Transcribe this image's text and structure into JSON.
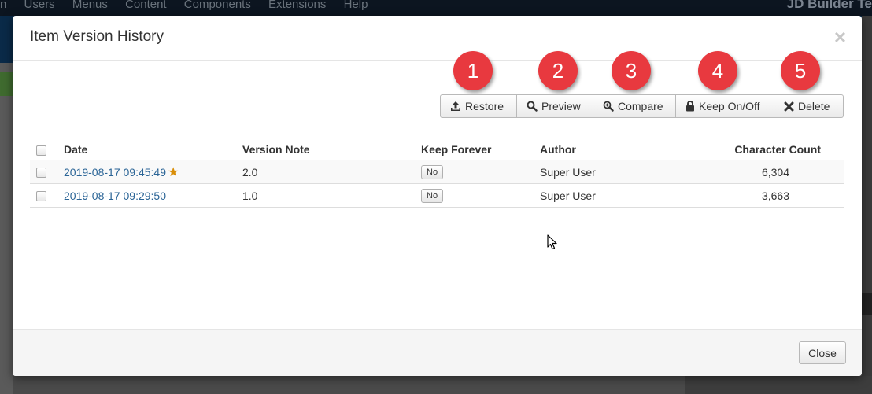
{
  "background": {
    "menu": [
      "n",
      "Users",
      "Menus",
      "Content",
      "Components",
      "Extensions",
      "Help"
    ],
    "brand": "JD Builder Te"
  },
  "modal": {
    "title": "Item Version History",
    "close_glyph": "×"
  },
  "toolbar": {
    "restore_label": "Restore",
    "preview_label": "Preview",
    "compare_label": "Compare",
    "keep_label": "Keep On/Off",
    "delete_label": "Delete"
  },
  "annotations": [
    "1",
    "2",
    "3",
    "4",
    "5"
  ],
  "table": {
    "columns": [
      "Date",
      "Version Note",
      "Keep Forever",
      "Author",
      "Character Count"
    ],
    "rows": [
      {
        "date": "2019-08-17 09:45:49",
        "starred": true,
        "note": "2.0",
        "keep": "No",
        "author": "Super User",
        "count": "6,304"
      },
      {
        "date": "2019-08-17 09:29:50",
        "starred": false,
        "note": "1.0",
        "keep": "No",
        "author": "Super User",
        "count": "3,663"
      }
    ]
  },
  "footer": {
    "close_label": "Close"
  },
  "colors": {
    "badge": "#e8393f",
    "link": "#2a6496",
    "star": "#d98e08"
  }
}
